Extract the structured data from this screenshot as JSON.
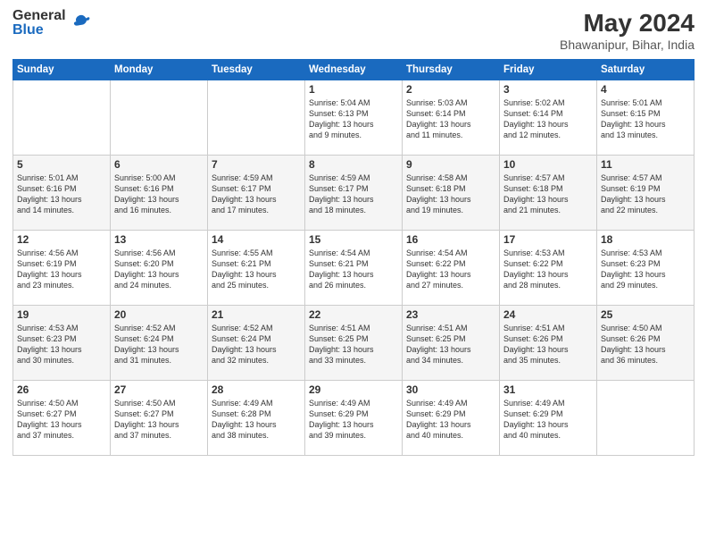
{
  "header": {
    "logo_general": "General",
    "logo_blue": "Blue",
    "month_year": "May 2024",
    "location": "Bhawanipur, Bihar, India"
  },
  "days_of_week": [
    "Sunday",
    "Monday",
    "Tuesday",
    "Wednesday",
    "Thursday",
    "Friday",
    "Saturday"
  ],
  "weeks": [
    [
      {
        "day": "",
        "info": ""
      },
      {
        "day": "",
        "info": ""
      },
      {
        "day": "",
        "info": ""
      },
      {
        "day": "1",
        "info": "Sunrise: 5:04 AM\nSunset: 6:13 PM\nDaylight: 13 hours\nand 9 minutes."
      },
      {
        "day": "2",
        "info": "Sunrise: 5:03 AM\nSunset: 6:14 PM\nDaylight: 13 hours\nand 11 minutes."
      },
      {
        "day": "3",
        "info": "Sunrise: 5:02 AM\nSunset: 6:14 PM\nDaylight: 13 hours\nand 12 minutes."
      },
      {
        "day": "4",
        "info": "Sunrise: 5:01 AM\nSunset: 6:15 PM\nDaylight: 13 hours\nand 13 minutes."
      }
    ],
    [
      {
        "day": "5",
        "info": "Sunrise: 5:01 AM\nSunset: 6:16 PM\nDaylight: 13 hours\nand 14 minutes."
      },
      {
        "day": "6",
        "info": "Sunrise: 5:00 AM\nSunset: 6:16 PM\nDaylight: 13 hours\nand 16 minutes."
      },
      {
        "day": "7",
        "info": "Sunrise: 4:59 AM\nSunset: 6:17 PM\nDaylight: 13 hours\nand 17 minutes."
      },
      {
        "day": "8",
        "info": "Sunrise: 4:59 AM\nSunset: 6:17 PM\nDaylight: 13 hours\nand 18 minutes."
      },
      {
        "day": "9",
        "info": "Sunrise: 4:58 AM\nSunset: 6:18 PM\nDaylight: 13 hours\nand 19 minutes."
      },
      {
        "day": "10",
        "info": "Sunrise: 4:57 AM\nSunset: 6:18 PM\nDaylight: 13 hours\nand 21 minutes."
      },
      {
        "day": "11",
        "info": "Sunrise: 4:57 AM\nSunset: 6:19 PM\nDaylight: 13 hours\nand 22 minutes."
      }
    ],
    [
      {
        "day": "12",
        "info": "Sunrise: 4:56 AM\nSunset: 6:19 PM\nDaylight: 13 hours\nand 23 minutes."
      },
      {
        "day": "13",
        "info": "Sunrise: 4:56 AM\nSunset: 6:20 PM\nDaylight: 13 hours\nand 24 minutes."
      },
      {
        "day": "14",
        "info": "Sunrise: 4:55 AM\nSunset: 6:21 PM\nDaylight: 13 hours\nand 25 minutes."
      },
      {
        "day": "15",
        "info": "Sunrise: 4:54 AM\nSunset: 6:21 PM\nDaylight: 13 hours\nand 26 minutes."
      },
      {
        "day": "16",
        "info": "Sunrise: 4:54 AM\nSunset: 6:22 PM\nDaylight: 13 hours\nand 27 minutes."
      },
      {
        "day": "17",
        "info": "Sunrise: 4:53 AM\nSunset: 6:22 PM\nDaylight: 13 hours\nand 28 minutes."
      },
      {
        "day": "18",
        "info": "Sunrise: 4:53 AM\nSunset: 6:23 PM\nDaylight: 13 hours\nand 29 minutes."
      }
    ],
    [
      {
        "day": "19",
        "info": "Sunrise: 4:53 AM\nSunset: 6:23 PM\nDaylight: 13 hours\nand 30 minutes."
      },
      {
        "day": "20",
        "info": "Sunrise: 4:52 AM\nSunset: 6:24 PM\nDaylight: 13 hours\nand 31 minutes."
      },
      {
        "day": "21",
        "info": "Sunrise: 4:52 AM\nSunset: 6:24 PM\nDaylight: 13 hours\nand 32 minutes."
      },
      {
        "day": "22",
        "info": "Sunrise: 4:51 AM\nSunset: 6:25 PM\nDaylight: 13 hours\nand 33 minutes."
      },
      {
        "day": "23",
        "info": "Sunrise: 4:51 AM\nSunset: 6:25 PM\nDaylight: 13 hours\nand 34 minutes."
      },
      {
        "day": "24",
        "info": "Sunrise: 4:51 AM\nSunset: 6:26 PM\nDaylight: 13 hours\nand 35 minutes."
      },
      {
        "day": "25",
        "info": "Sunrise: 4:50 AM\nSunset: 6:26 PM\nDaylight: 13 hours\nand 36 minutes."
      }
    ],
    [
      {
        "day": "26",
        "info": "Sunrise: 4:50 AM\nSunset: 6:27 PM\nDaylight: 13 hours\nand 37 minutes."
      },
      {
        "day": "27",
        "info": "Sunrise: 4:50 AM\nSunset: 6:27 PM\nDaylight: 13 hours\nand 37 minutes."
      },
      {
        "day": "28",
        "info": "Sunrise: 4:49 AM\nSunset: 6:28 PM\nDaylight: 13 hours\nand 38 minutes."
      },
      {
        "day": "29",
        "info": "Sunrise: 4:49 AM\nSunset: 6:29 PM\nDaylight: 13 hours\nand 39 minutes."
      },
      {
        "day": "30",
        "info": "Sunrise: 4:49 AM\nSunset: 6:29 PM\nDaylight: 13 hours\nand 40 minutes."
      },
      {
        "day": "31",
        "info": "Sunrise: 4:49 AM\nSunset: 6:29 PM\nDaylight: 13 hours\nand 40 minutes."
      },
      {
        "day": "",
        "info": ""
      }
    ]
  ]
}
